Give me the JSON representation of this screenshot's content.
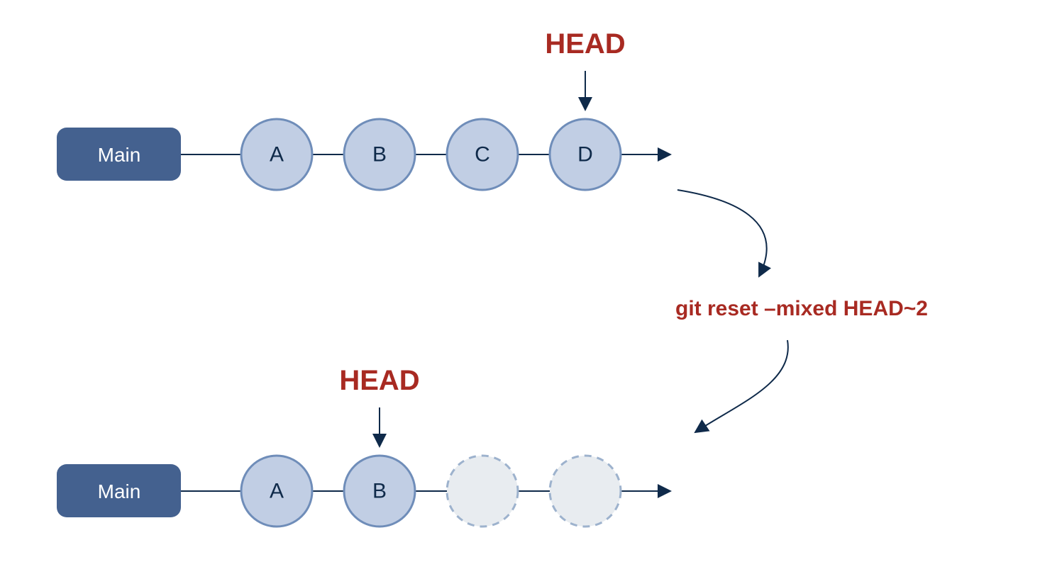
{
  "colors": {
    "branch_fill": "#44618f",
    "commit_fill": "#c1cee4",
    "commit_stroke": "#6f8db9",
    "ghost_fill": "#e8ecf0",
    "ghost_stroke": "#9db2cd",
    "line": "#0f2a4a",
    "accent": "#a82a22"
  },
  "labels": {
    "head_top": "HEAD",
    "head_bottom": "HEAD",
    "command": "git reset –mixed HEAD~2"
  },
  "top": {
    "branch": "Main",
    "commits": [
      {
        "id": "A",
        "ghost": false
      },
      {
        "id": "B",
        "ghost": false
      },
      {
        "id": "C",
        "ghost": false
      },
      {
        "id": "D",
        "ghost": false
      }
    ],
    "head_on": "D"
  },
  "bottom": {
    "branch": "Main",
    "commits": [
      {
        "id": "A",
        "ghost": false
      },
      {
        "id": "B",
        "ghost": false
      },
      {
        "id": "",
        "ghost": true
      },
      {
        "id": "",
        "ghost": true
      }
    ],
    "head_on": "B"
  }
}
